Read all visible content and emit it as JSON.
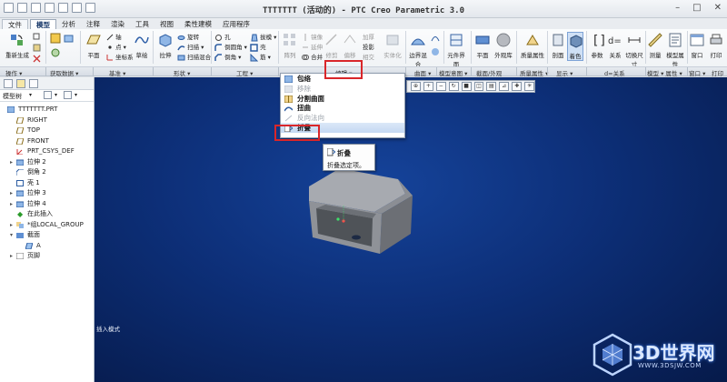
{
  "window": {
    "title": "TTTTTTT (活动的) - PTC Creo Parametric 3.0"
  },
  "menu_tabs": [
    {
      "label": "文件"
    },
    {
      "label": "模型"
    },
    {
      "label": "分析"
    },
    {
      "label": "注释"
    },
    {
      "label": "渲染"
    },
    {
      "label": "工具"
    },
    {
      "label": "视图"
    },
    {
      "label": "柔性建模"
    },
    {
      "label": "应用程序"
    }
  ],
  "ribbon": {
    "regenerate": "重新生成",
    "plane": "平面",
    "axis": "轴",
    "point": "点",
    "coord_sys": "坐标系",
    "sketch": "草绘",
    "extrude": "拉伸",
    "revolve": "旋转",
    "sweep": "扫描",
    "swept_blend": "扫描混合",
    "hole": "孔",
    "round": "倒圆角",
    "chamfer": "倒角",
    "draft": "拔模",
    "shell": "壳",
    "rib": "筋",
    "pattern": "阵列",
    "mirror": "镜像",
    "extend": "延伸",
    "trim": "修剪",
    "offset": "偏移",
    "intersect": "相交",
    "merge": "合并",
    "thicken": "加厚",
    "solidify": "实体化",
    "project": "投影",
    "boundary_blend": "边界混合",
    "style": "样式",
    "freestyle": "造型",
    "component_interface": "元件界面",
    "plane2": "平面",
    "appearance_gallery": "外观库",
    "mass_props": "质量属性",
    "section": "剖面",
    "shade": "着色",
    "params": "参数",
    "relations": "关系",
    "switch_dims": "切换尺寸",
    "measure": "测量",
    "model_props": "模型属性",
    "window": "窗口",
    "print": "打印"
  },
  "groups": [
    {
      "label": "操作 ▾"
    },
    {
      "label": "获取数据 ▾"
    },
    {
      "label": "基准 ▾"
    },
    {
      "label": "形状 ▾"
    },
    {
      "label": "工程 ▾"
    },
    {
      "label": "编辑 ▾"
    },
    {
      "label": "曲面 ▾"
    },
    {
      "label": "模型意图 ▾"
    },
    {
      "label": "截面/外观"
    },
    {
      "label": "质量属性 ▾"
    },
    {
      "label": "显示 ▾"
    },
    {
      "label": "d=关系"
    },
    {
      "label": "模型 ▾ 属性 ▾"
    },
    {
      "label": "窗口 ▾"
    },
    {
      "label": "打印"
    }
  ],
  "model_tree": {
    "header": "模型树",
    "items": [
      {
        "label": "TTTTTTT.PRT"
      },
      {
        "label": "RIGHT"
      },
      {
        "label": "TOP"
      },
      {
        "label": "FRONT"
      },
      {
        "label": "PRT_CSYS_DEF"
      },
      {
        "label": "拉伸 2"
      },
      {
        "label": "倒角 2"
      },
      {
        "label": "壳 1"
      },
      {
        "label": "拉伸 3"
      },
      {
        "label": "拉伸 4"
      },
      {
        "label": "在此插入"
      },
      {
        "label": "*组LOCAL_GROUP"
      },
      {
        "label": "截面"
      },
      {
        "label": "A"
      },
      {
        "label": "页脚"
      }
    ]
  },
  "edit_menu": {
    "items": [
      {
        "label": "包络",
        "disabled": false
      },
      {
        "label": "移除",
        "disabled": true
      },
      {
        "label": "分割曲面",
        "disabled": false
      },
      {
        "label": "扭曲",
        "disabled": false
      },
      {
        "label": "反向法向",
        "disabled": true
      },
      {
        "label": "折叠",
        "disabled": false,
        "selected": true
      }
    ]
  },
  "tooltip": {
    "title": "折叠",
    "description": "折叠选定项。"
  },
  "status": {
    "text": "插入模式"
  },
  "watermark": {
    "brand": "3D世界网",
    "url": "WWW.3DSJW.COM"
  },
  "colors": {
    "viewport_center": "#15439a",
    "viewport_edge": "#061a4a",
    "highlight_box": "#d9262a",
    "model_gray": "#9aa0a8"
  }
}
